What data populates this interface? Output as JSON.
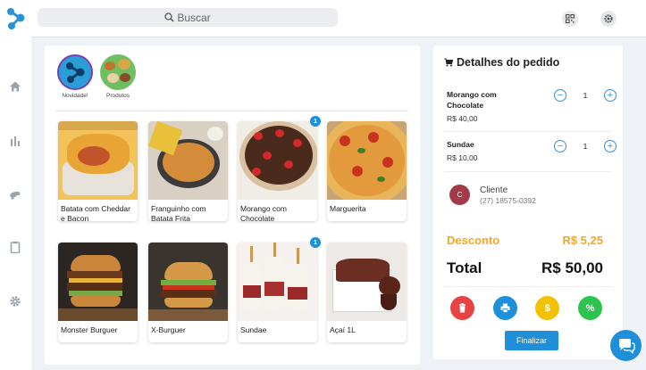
{
  "search": {
    "placeholder": "Buscar"
  },
  "categories": [
    {
      "label": "Novidade!"
    },
    {
      "label": "Produtos"
    }
  ],
  "products": [
    {
      "name": "Batata com Cheddar e Bacon",
      "badge": ""
    },
    {
      "name": "Franguinho com Batata Frita",
      "badge": ""
    },
    {
      "name": "Morango com Chocolate",
      "badge": "1"
    },
    {
      "name": "Marguerita",
      "badge": ""
    },
    {
      "name": "Monster Burguer",
      "badge": ""
    },
    {
      "name": "X-Burguer",
      "badge": ""
    },
    {
      "name": "Sundae",
      "badge": "1"
    },
    {
      "name": "Açaí 1L",
      "badge": ""
    }
  ],
  "order": {
    "title": "Detalhes do pedido",
    "items": [
      {
        "name": "Morango com Chocolate",
        "price": "R$ 40,00",
        "qty": "1",
        "minus": "−",
        "plus": "+"
      },
      {
        "name": "Sundae",
        "price": "R$ 10,00",
        "qty": "1",
        "minus": "−",
        "plus": "+"
      }
    ],
    "client": {
      "initial": "C",
      "name": "Cliente",
      "phone": "(27) 18575-0392"
    },
    "discount": {
      "label": "Desconto",
      "value": "R$ 5,25"
    },
    "total": {
      "label": "Total",
      "value": "R$ 50,00"
    },
    "actions": {
      "coupon_symbol": "$",
      "percent_symbol": "%"
    },
    "finish_label": "Finalizar"
  },
  "colors": {
    "accent": "#1e8fd8",
    "discount": "#f5a623",
    "delete": "#e74343",
    "print": "#1e8fd8",
    "coupon": "#f2c200",
    "percent": "#2bc44f"
  }
}
